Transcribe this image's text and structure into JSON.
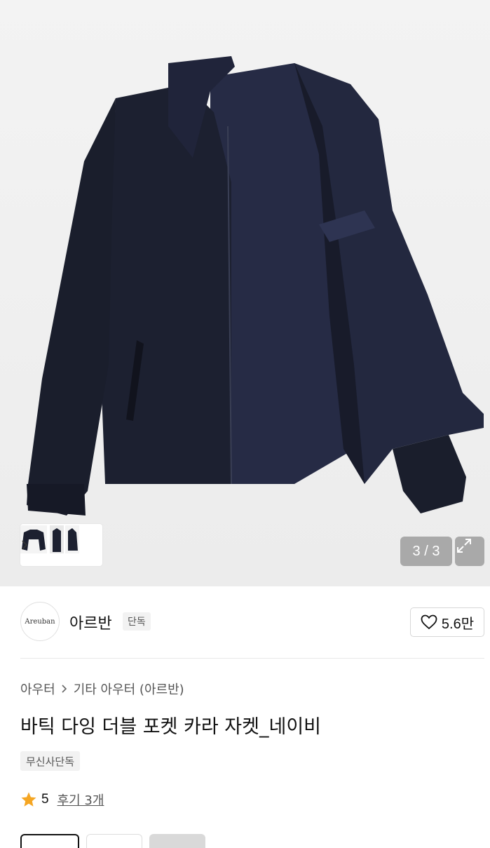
{
  "gallery": {
    "counter": "3 / 3",
    "thumbnail_count": 3
  },
  "brand": {
    "logo_text": "Areuban",
    "name": "아르반",
    "badge": "단독"
  },
  "like": {
    "count": "5.6만",
    "icon": "heart-outline-icon"
  },
  "breadcrumb": {
    "items": [
      "아우터",
      "기타 아우터 (아르반)"
    ]
  },
  "product": {
    "title": "바틱 다잉 더블 포켓 카라 자켓_네이비",
    "tag": "무신사단독",
    "rating": "5",
    "reviews_label": "후기 3개"
  },
  "colors": {
    "star": "#f5a623",
    "jacket": "#1c2030",
    "lining": "#262b45"
  }
}
